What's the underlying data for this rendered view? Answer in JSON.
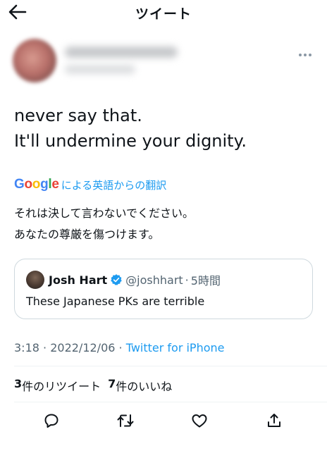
{
  "header": {
    "title": "ツイート",
    "back_icon": "back-arrow-icon"
  },
  "author": {
    "avatar": "avatar-blurred",
    "name_obscured": true,
    "more_icon": "more-icon"
  },
  "tweet": {
    "lines": [
      "never say that.",
      "It'll undermine your dignity."
    ],
    "translation_label": "による英語からの翻訳",
    "google_logo": {
      "letters": [
        "G",
        "o",
        "o",
        "g",
        "l",
        "e"
      ],
      "colors": [
        "#4285F4",
        "#EA4335",
        "#FBBC05",
        "#4285F4",
        "#34A853",
        "#EA4335"
      ]
    },
    "translated_lines": [
      "それは決して言わないでください。",
      "あなたの尊厳を傷つけます。"
    ]
  },
  "quote": {
    "name": "Josh Hart",
    "handle": "@joshhart",
    "separator": "·",
    "time": "5時間",
    "text": "These Japanese PKs are terrible",
    "verified_color": "#1d9bf0"
  },
  "meta": {
    "time": "3:18",
    "separator": " · ",
    "date": "2022/12/06",
    "source": "Twitter for iPhone"
  },
  "stats": {
    "retweet_count": "3",
    "retweet_label": "件のリツイート",
    "like_count": "7",
    "like_label": "件のいいね"
  },
  "actions": {
    "reply_icon": "reply-icon",
    "retweet_icon": "retweet-icon",
    "like_icon": "like-icon",
    "share_icon": "share-icon"
  },
  "colors": {
    "accent": "#1d9bf0",
    "secondary_text": "#536471",
    "divider": "#eff3f4"
  }
}
